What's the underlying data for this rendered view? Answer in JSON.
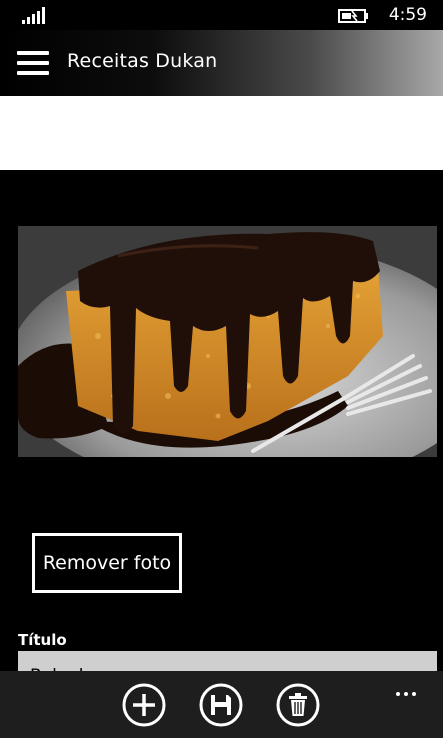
{
  "status_bar": {
    "time": "4:59",
    "icons": [
      "signal-strength-icon",
      "battery-charging-icon"
    ]
  },
  "header": {
    "menu_icon": "hamburger-menu-icon",
    "title": "Receitas Dukan"
  },
  "photo": {
    "subject": "recipe-photo"
  },
  "remove_button": {
    "label": "Remover foto"
  },
  "title_field": {
    "label": "Título",
    "value": "Bolo de"
  },
  "app_bar": {
    "buttons": [
      "add-icon",
      "save-icon",
      "delete-icon"
    ],
    "more_icon": "ellipsis-icon"
  },
  "colors": {
    "background": "#000000",
    "header_gradient_end": "#a8a8a8",
    "appbar": "#1e1e1e",
    "input_bg": "#cfcfcf",
    "cake": "#d7902a",
    "chocolate": "#1f0f08"
  }
}
